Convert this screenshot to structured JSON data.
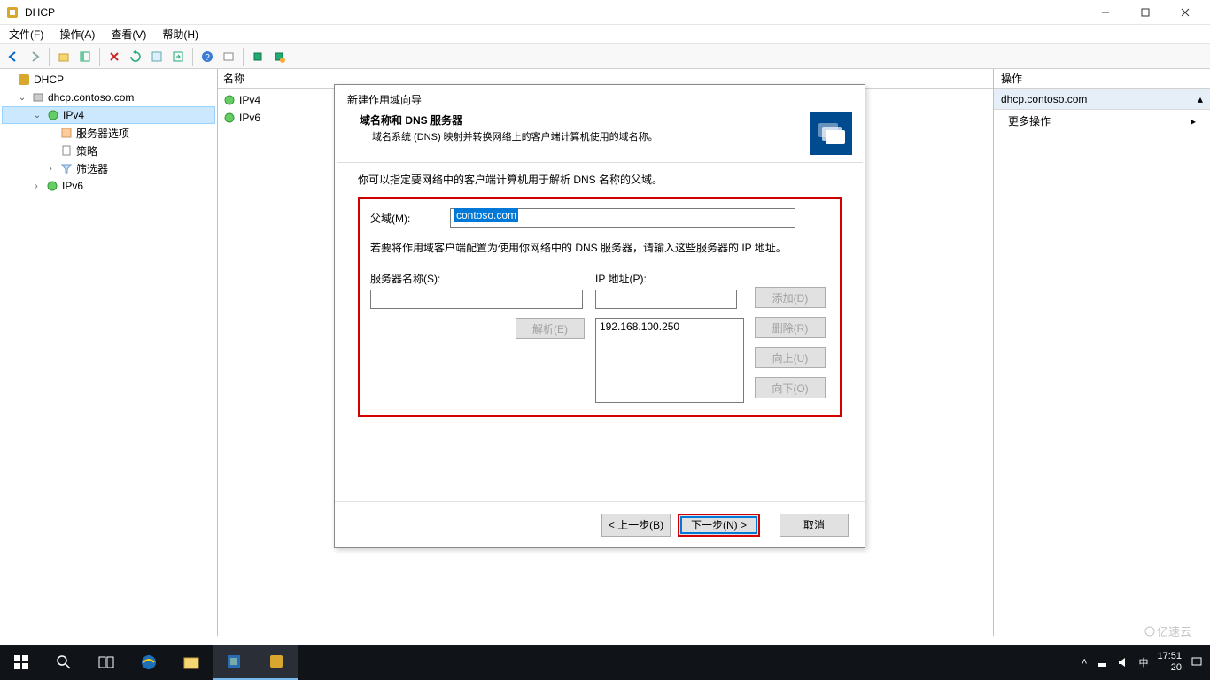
{
  "window": {
    "title": "DHCP"
  },
  "menubar": [
    "文件(F)",
    "操作(A)",
    "查看(V)",
    "帮助(H)"
  ],
  "tree": {
    "root": "DHCP",
    "server": "dhcp.contoso.com",
    "ipv4": "IPv4",
    "ipv4_children": [
      "服务器选项",
      "策略",
      "筛选器"
    ],
    "ipv6": "IPv6"
  },
  "mid": {
    "header": "名称",
    "items": [
      "IPv4",
      "IPv6"
    ]
  },
  "actions": {
    "header": "操作",
    "sub": "dhcp.contoso.com",
    "more": "更多操作"
  },
  "wizard": {
    "title": "新建作用域向导",
    "heading": "域名称和 DNS 服务器",
    "subheading": "域名系统 (DNS) 映射并转换网络上的客户端计算机使用的域名称。",
    "instruction": "你可以指定要网络中的客户端计算机用于解析 DNS 名称的父域。",
    "parent_label": "父域(M):",
    "parent_value": "contoso.com",
    "dns_instruction": "若要将作用域客户端配置为使用你网络中的 DNS 服务器，请输入这些服务器的 IP 地址。",
    "server_name_label": "服务器名称(S):",
    "ip_label": "IP 地址(P):",
    "ip_list": [
      "192.168.100.250"
    ],
    "btn_resolve": "解析(E)",
    "btn_add": "添加(D)",
    "btn_remove": "删除(R)",
    "btn_up": "向上(U)",
    "btn_down": "向下(O)",
    "btn_back": "< 上一步(B)",
    "btn_next": "下一步(N) >",
    "btn_cancel": "取消",
    "server_name_value": "",
    "ip_value": ""
  },
  "taskbar": {
    "time": "17:51",
    "date_prefix": "20",
    "ime": "中"
  },
  "watermark": "亿速云"
}
